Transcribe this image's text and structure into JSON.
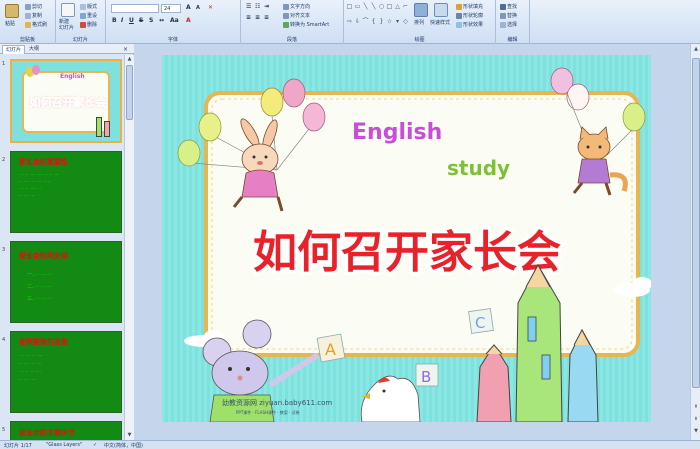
{
  "ribbon": {
    "groups": {
      "clipboard": "剪贴板",
      "slides": "幻灯片",
      "font": "字体",
      "paragraph": "段落",
      "drawing": "绘图",
      "editing": "编辑"
    },
    "clipboard": {
      "paste": "粘贴",
      "cut": "剪切",
      "copy": "复制",
      "format_painter": "格式刷"
    },
    "slides": {
      "new_slide": "新建\n幻灯片",
      "layout": "版式",
      "reset": "重设",
      "delete": "删除"
    },
    "font": {
      "font_name": "",
      "font_size": "24"
    },
    "paragraph": {
      "text_direction": "文字方向",
      "align_text": "对齐文本",
      "convert_smartart": "转换为 SmartArt"
    },
    "drawing": {
      "arrange": "排列",
      "quick_styles": "快速样式",
      "shape_fill": "形状填充",
      "shape_outline": "形状轮廓",
      "shape_effects": "形状效果"
    },
    "editing": {
      "find": "查找",
      "replace": "替换",
      "select": "选择"
    }
  },
  "panel": {
    "tab_slides": "幻灯片",
    "tab_outline": "大纲"
  },
  "thumbnails": [
    {
      "num": "1",
      "title": "如何召开家长会"
    },
    {
      "num": "2",
      "title": "家长会的重要性",
      "lines": [
        "··· ·· ··· ···· ·· ·· ···",
        "·· ···· ·· ··· ·····",
        "··· ·· ···· ··",
        "·· ··· ···"
      ]
    },
    {
      "num": "3",
      "title": "家长会时间安排",
      "lines": [
        "一、··· ···· ··",
        "二、··· ·· ····",
        "三、···· ··· ··"
      ]
    },
    {
      "num": "4",
      "title": "老师要做的准备",
      "lines": [
        "··· ··· ·· ····",
        "·· ···· ·· ···",
        "··· ·· ·· ····",
        "·· ··· ····"
      ]
    },
    {
      "num": "5",
      "title": "家长会的主要环节"
    }
  ],
  "slide": {
    "title": "如何召开家长会",
    "english": "English",
    "study": "study",
    "watermark": "幼教资源网 ziyuan.baby611.com",
    "watermark_sub": "PPT课件 · FLASH课件 · 教案 · 试卷",
    "block_a": "A",
    "block_b": "B",
    "block_c": "C"
  },
  "status": {
    "slide_count": "幻灯片 1/17",
    "theme": "\"Glass Layers\"",
    "language": "中文(简体，中国)"
  },
  "colors": {
    "title_fill": "#e8212a",
    "title_outline": "#ffffff",
    "slide_bg": "#7fe1dd",
    "thumb_bg": "#138a13",
    "thumb_title": "#e01010"
  }
}
